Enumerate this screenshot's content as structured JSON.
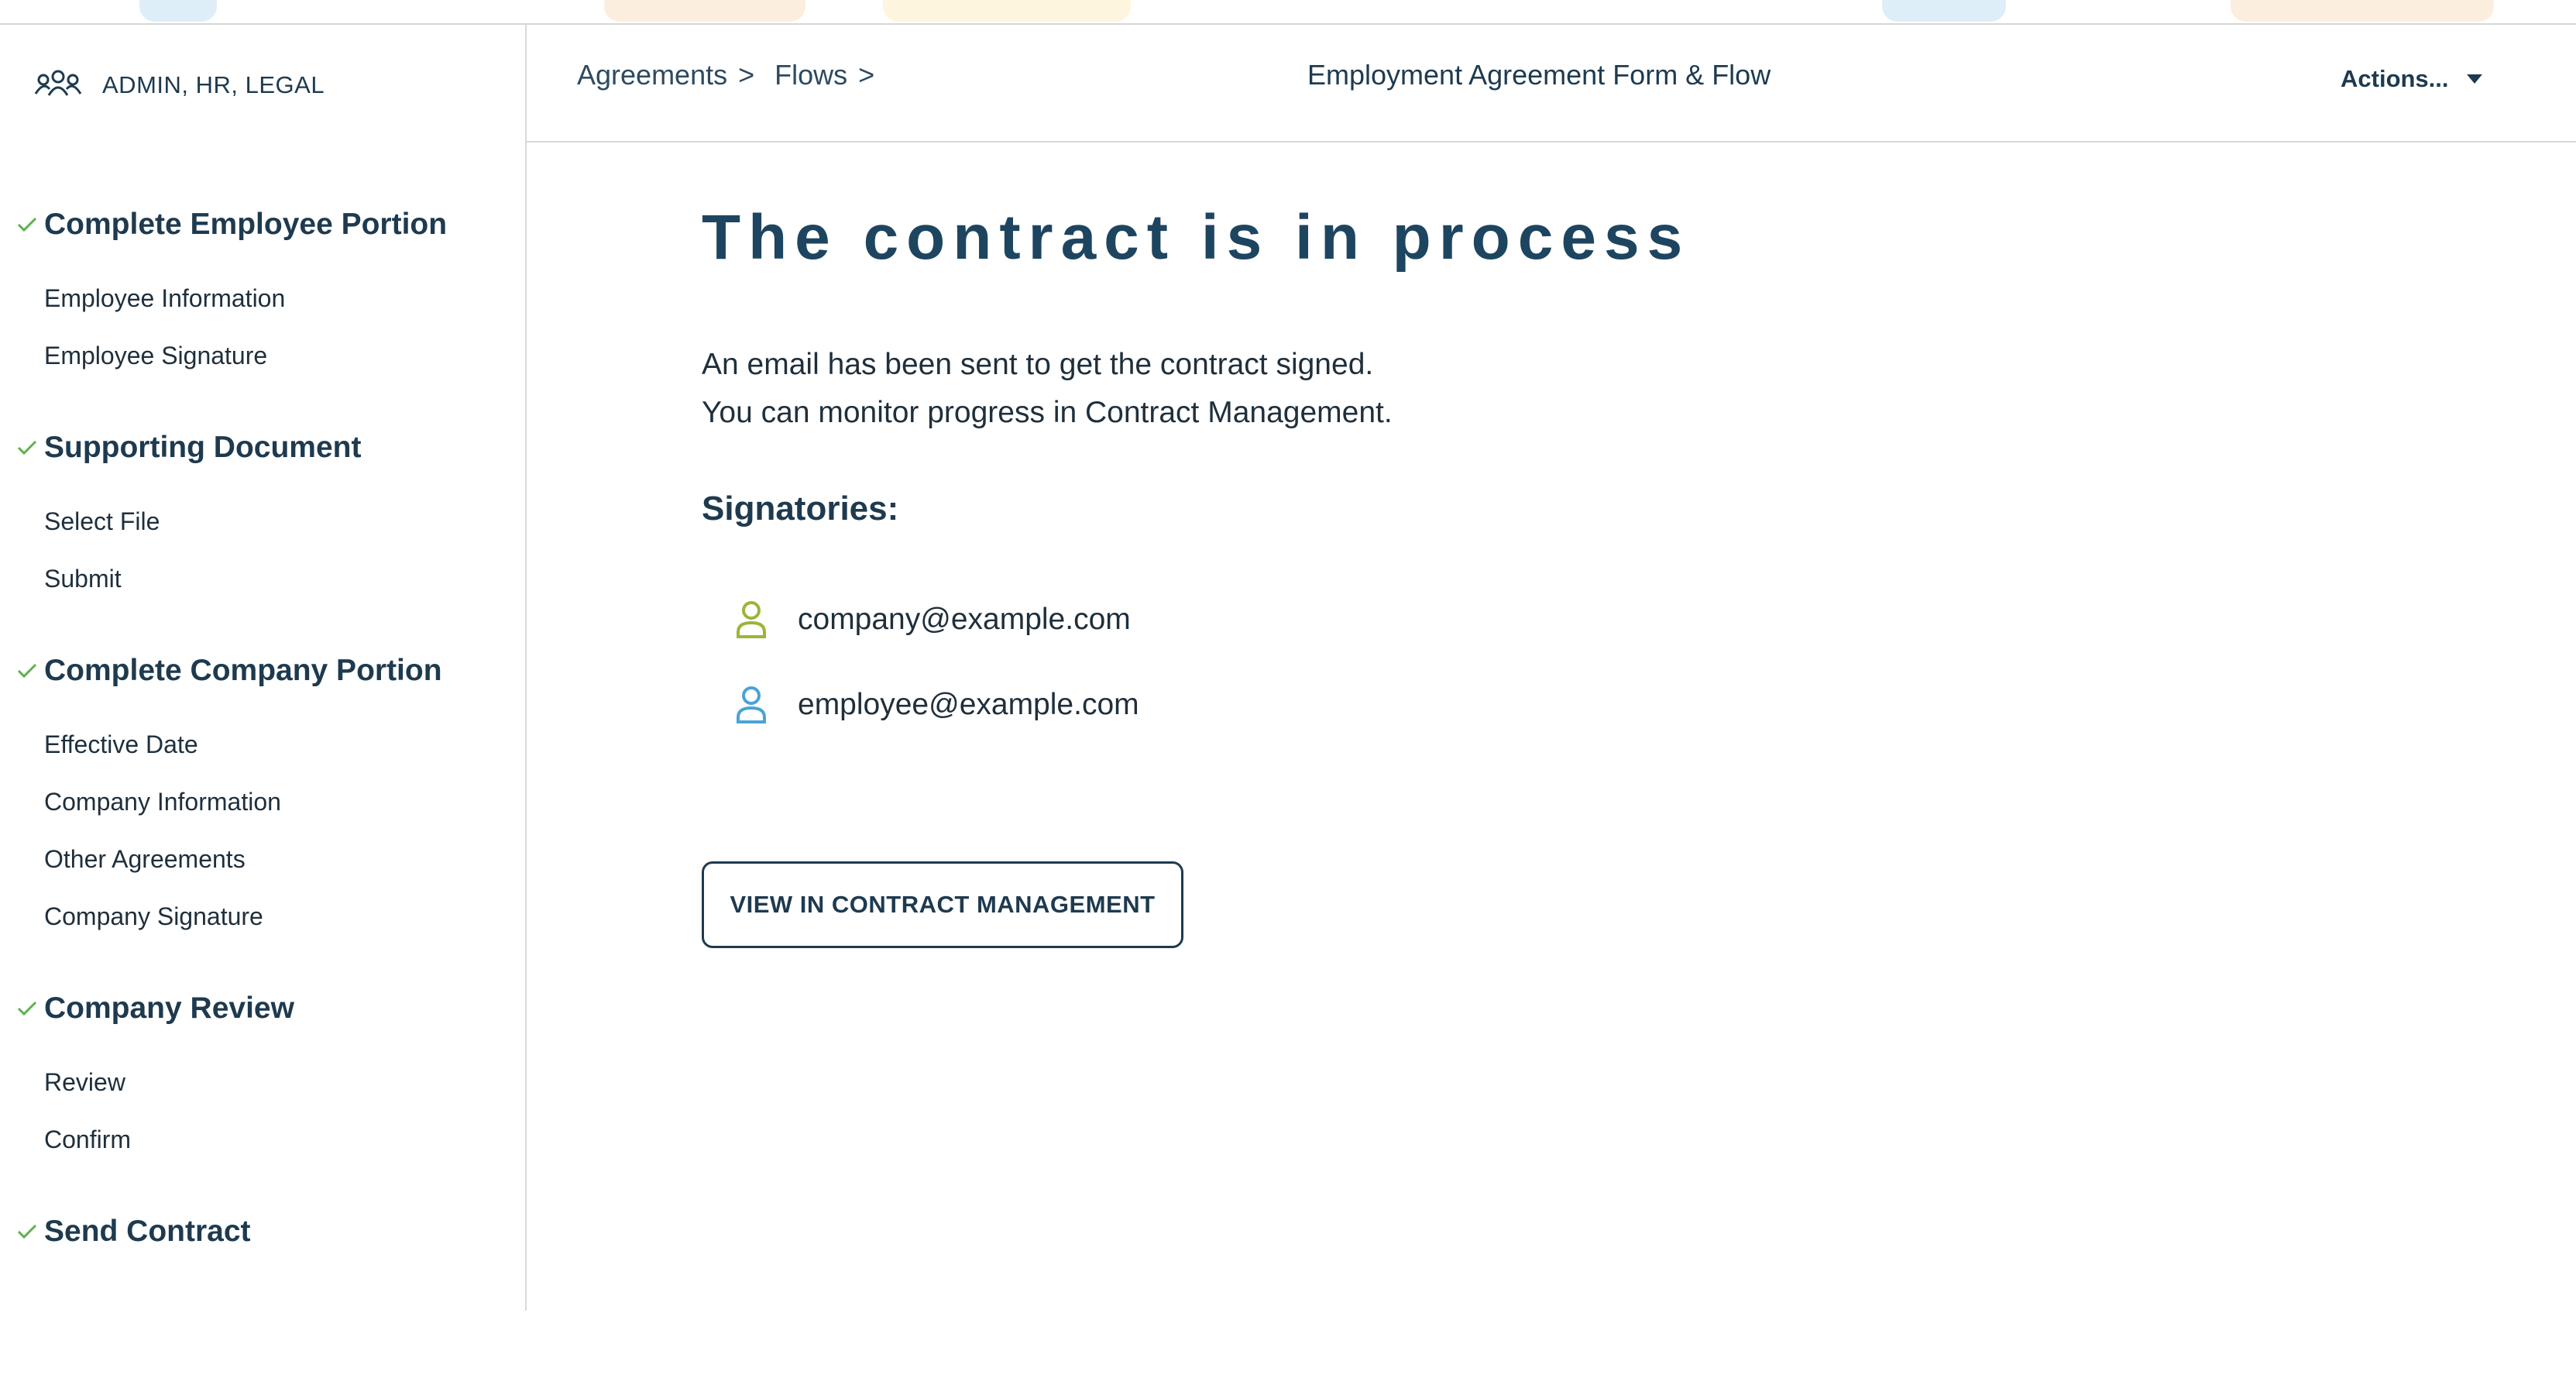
{
  "sidebar": {
    "team_label": "ADMIN, HR, LEGAL",
    "steps": [
      {
        "title": "Complete Employee Portion",
        "items": [
          "Employee Information",
          "Employee Signature"
        ]
      },
      {
        "title": "Supporting Document",
        "items": [
          "Select File",
          "Submit"
        ]
      },
      {
        "title": "Complete Company Portion",
        "items": [
          "Effective Date",
          "Company Information",
          "Other Agreements",
          "Company Signature"
        ]
      },
      {
        "title": "Company Review",
        "items": [
          "Review",
          "Confirm"
        ]
      },
      {
        "title": "Send Contract",
        "items": []
      }
    ]
  },
  "header": {
    "breadcrumbs": [
      "Agreements",
      "Flows"
    ],
    "breadcrumb_separator": ">",
    "title": "Employment Agreement Form & Flow",
    "actions_label": "Actions..."
  },
  "main": {
    "heading": "The contract is in process",
    "message_lines": [
      "An email has been sent to get the contract signed.",
      "You can monitor progress in Contract Management."
    ],
    "signatories_label": "Signatories:",
    "signatories": [
      {
        "email": "company@example.com",
        "icon": "user-icon",
        "color": "#9bb53a"
      },
      {
        "email": "employee@example.com",
        "icon": "user-icon",
        "color": "#4aa3d6"
      }
    ],
    "button_label": "VIEW IN CONTRACT MANAGEMENT"
  },
  "colors": {
    "primary_text": "#1e3a4f",
    "check": "#5fb04e",
    "border": "#d8d8d8"
  }
}
